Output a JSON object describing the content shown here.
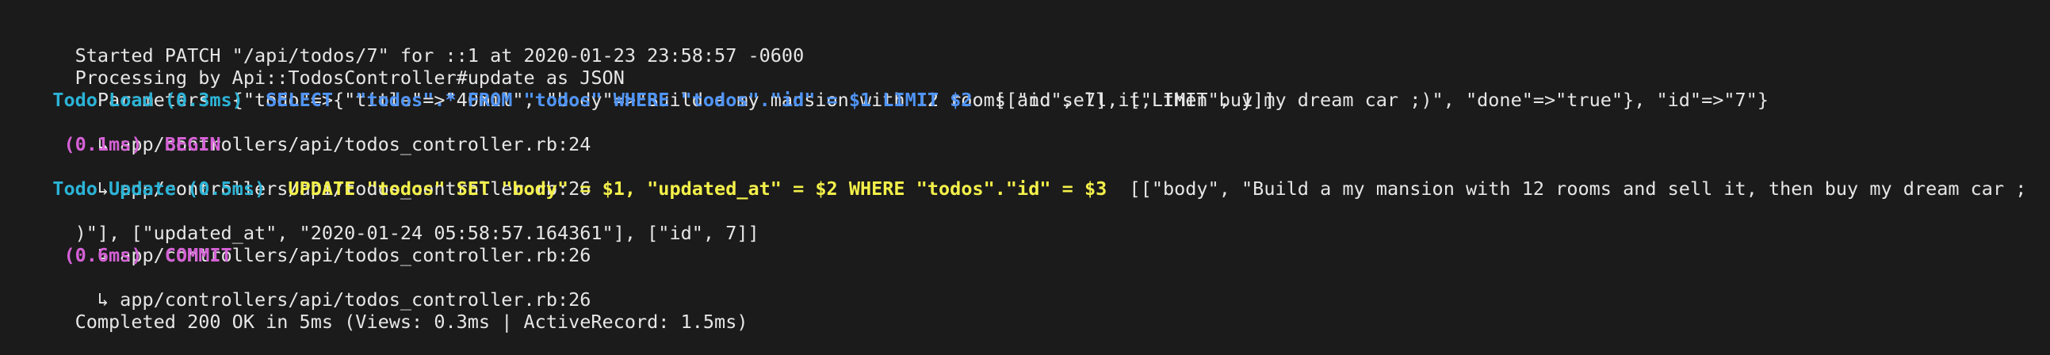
{
  "terminal": {
    "lines": {
      "started": "Started PATCH \"/api/todos/7\" for ::1 at 2020-01-23 23:58:57 -0600",
      "processing": "Processing by Api::TodosController#update as JSON",
      "parameters": "  Parameters: {\"todo\"=>{\"title\"=>\"40mil\", \"body\"=>\"Build a my mansion with 12 rooms and sell it, then buy my dream car ;)\", \"done\"=>\"true\"}, \"id\"=>\"7\"}",
      "load_prefix": "  ",
      "load_label": "Todo Load (0.3ms)",
      "load_gap": "  ",
      "load_sql": "SELECT  \"todos\".* FROM \"todos\" WHERE \"todos\".\"id\" = $1 LIMIT $2",
      "load_binds": "  [[\"id\", 7], [\"LIMIT\", 1]]",
      "trace_24": "  ↳ app/controllers/api/todos_controller.rb:24",
      "begin_prefix": "   ",
      "begin_time": "(0.1ms)",
      "begin_gap": "  ",
      "begin_sql": "BEGIN",
      "trace_26a": "  ↳ app/controllers/api/todos_controller.rb:26",
      "update_prefix": "  ",
      "update_label": "Todo Update (0.5ms)",
      "update_gap": "  ",
      "update_sql": "UPDATE \"todos\" SET \"body\" = $1, \"updated_at\" = $2 WHERE \"todos\".\"id\" = $3",
      "update_binds": "  [[\"body\", \"Build a my mansion with 12 rooms and sell it, then buy my dream car ;",
      "update_binds_cont": ")\"], [\"updated_at\", \"2020-01-24 05:58:57.164361\"], [\"id\", 7]]",
      "trace_26b": "  ↳ app/controllers/api/todos_controller.rb:26",
      "commit_prefix": "   ",
      "commit_time": "(0.6ms)",
      "commit_gap": "  ",
      "commit_sql": "COMMIT",
      "trace_26c": "  ↳ app/controllers/api/todos_controller.rb:26",
      "completed": "Completed 200 OK in 5ms (Views: 0.3ms | ActiveRecord: 1.5ms)"
    }
  },
  "colors": {
    "background": "#1b1b1b",
    "text": "#e6e6e6",
    "cyan": "#2bb3d6",
    "blue": "#4f94f5",
    "magenta": "#d561d6",
    "yellow": "#f3f04a"
  }
}
